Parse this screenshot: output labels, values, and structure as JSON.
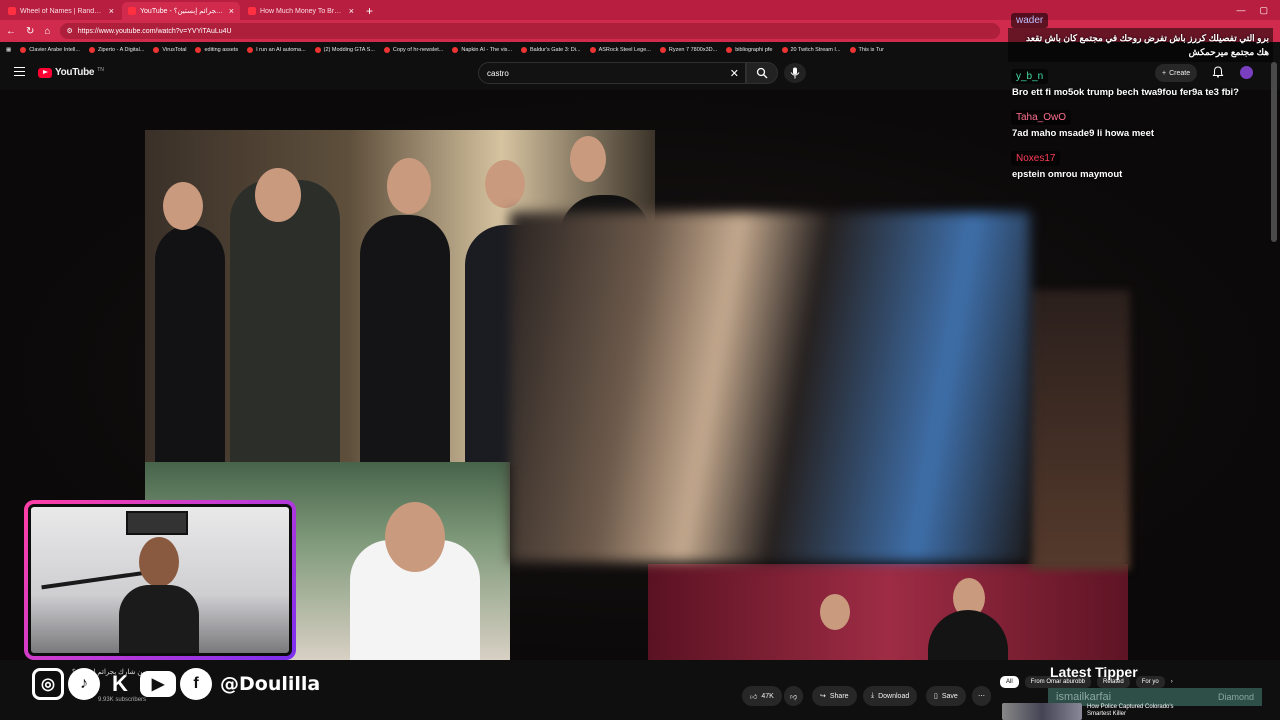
{
  "browser": {
    "tabs": [
      {
        "title": "Wheel of Names | Random name",
        "active": false
      },
      {
        "title": "YouTube - مين شارك بجرائم إبستين؟",
        "active": true
      },
      {
        "title": "How Much Money To Break Up W",
        "active": false
      }
    ],
    "new_tab": "+",
    "url": "https://www.youtube.com/watch?v=YVYiTAuLu4U",
    "bookmarks": [
      "Clavier Arabe Intell...",
      "Ziperto - A Digital...",
      "VirusTotal",
      "editing assets",
      "I run an AI automa...",
      "(2) Modding GTA S...",
      "Copy of hr-newslet...",
      "Napkin AI - The vis...",
      "Baldur's Gate 3: Di...",
      "ASRock Steel Lege...",
      "Ryzen 7 7800x3D...",
      "bibliographi pfe",
      "20 Twitch Stream I...",
      "This is Tur"
    ]
  },
  "youtube": {
    "logo_text": "YouTube",
    "logo_tm": "TN",
    "search_value": "castro",
    "create_label": "Create",
    "actions": {
      "likes": "47K",
      "share": "Share",
      "download": "Download",
      "save": "Save",
      "more": "⋯"
    },
    "video_title": "مين شارك بجرائم إبستين؟",
    "subscribers": "9.93K subscribers",
    "chips": [
      "All",
      "From Omar aburobb",
      "Related",
      "For yo"
    ],
    "rec_title": "How Police Captured Colorado's Smartest Killer"
  },
  "chat": [
    {
      "user": "wader",
      "text": "برو التي تفصيلك كررز باش تفرض روحك في مجتمع كان باش تقعد هك مجتمع ميرحمكش",
      "color": "#bfbfff"
    },
    {
      "user": "y_b_n",
      "text": "Bro ett fi mo5ok trump bech twa9fou fer9a te3 fbi?",
      "color": "#44e0a8"
    },
    {
      "user": "Taha_OwO",
      "text": "7ad maho msade9 li howa meet",
      "color": "#ff6f8f"
    },
    {
      "user": "Noxes17",
      "text": "epstein omrou maymout",
      "color": "#ff3d5a"
    }
  ],
  "overlay": {
    "handle": "@Doulilla",
    "latest_tipper_label": "Latest Tipper",
    "latest_tipper_name": "ismailkarfai",
    "tipper_tag": "Diamond"
  },
  "colors": {
    "tab_bar": "#b81e3f",
    "yt_red": "#ff0033",
    "webcam_border": "#ff3fa4"
  }
}
